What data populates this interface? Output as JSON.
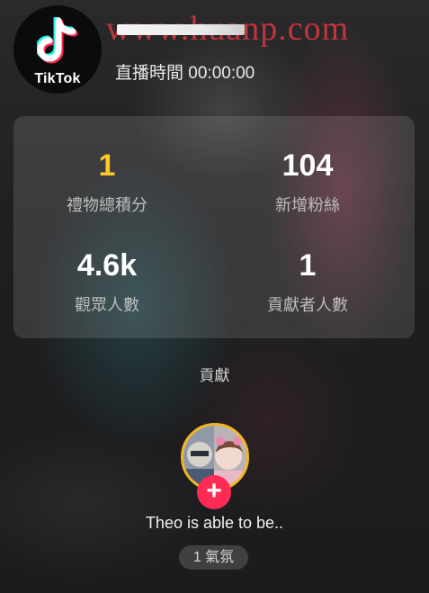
{
  "header": {
    "logo_text": "TikTok",
    "live_time_label": "直播時間 00:00:00",
    "watermark": "www.huanp.com"
  },
  "stats": [
    {
      "value": "1",
      "label": "禮物總積分",
      "value_color": "#ffc928"
    },
    {
      "value": "104",
      "label": "新增粉絲"
    },
    {
      "value": "4.6k",
      "label": "觀眾人數"
    },
    {
      "value": "1",
      "label": "貢獻者人數"
    }
  ],
  "contribution": {
    "title": "貢獻",
    "add_icon": "plus-icon",
    "add_symbol": "+",
    "contributor_name": "Theo is able to be..",
    "vibe_badge": "1 氣氛"
  },
  "colors": {
    "accent_gold": "#ffc928",
    "accent_red": "#fe2c55",
    "avatar_ring": "#f3b623",
    "watermark_red": "#ce363e"
  }
}
